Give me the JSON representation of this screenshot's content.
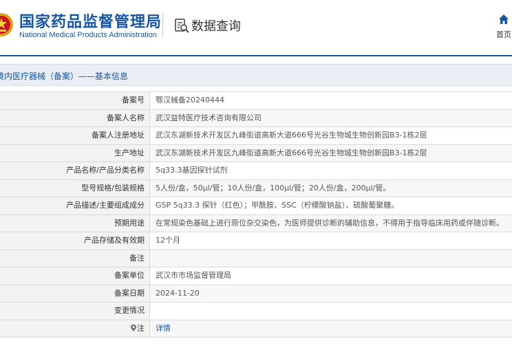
{
  "header": {
    "brand_cn": "国家药品监督管理局",
    "brand_en": "National Medical Products Administration",
    "query_label": "数据查询",
    "home_label": "首页",
    "brand_color": "#1556a6",
    "icons": {
      "emblem": "national-emblem-icon",
      "query": "search-document-icon",
      "home": "home-icon"
    }
  },
  "section": {
    "title": "境内医疗器械（备案）——基本信息"
  },
  "rows": [
    {
      "label": "备案号",
      "value": "鄂汉械备20240444"
    },
    {
      "label": "备案人名称",
      "value": "武汉益特医疗技术咨询有限公司"
    },
    {
      "label": "备案人注册地址",
      "value": "武汉东湖新技术开发区九峰街道高新大道666号光谷生物城生物创新园B3-1栋2层"
    },
    {
      "label": "生产地址",
      "value": "武汉东湖新技术开发区九峰街道高新大道666号光谷生物城生物创新园B3-1栋2层"
    },
    {
      "label": "产品名称/产品分类名称",
      "value": "5q33.3基因探针试剂"
    },
    {
      "label": "型号规格/包装规格",
      "value": "5人份/盒，50μl/管；10人份/盒，100μl/管；20人份/盒，200μl/管。"
    },
    {
      "label": "产品描述/主要组成成分",
      "value": "GSP 5q33.3 探针（红色）；甲酰胺、SSC（柠檬酸钠盐）、硫酸葡聚糖。"
    },
    {
      "label": "预期用途",
      "value": "在常规染色基础上进行原位杂交染色，为医师提供诊断的辅助信息，不得用于指导临床用药或伴随诊断。"
    },
    {
      "label": "产品存储及有效期",
      "value": "12个月"
    },
    {
      "label": "备注",
      "value": ""
    },
    {
      "label": "备案单位",
      "value": "武汉市市场监督管理局"
    },
    {
      "label": "备案日期",
      "value": "2024-11-20"
    },
    {
      "label": "变更情况",
      "value": ""
    }
  ],
  "note_row": {
    "label": "注",
    "link_text": "详情",
    "icon": "location-pin-icon"
  }
}
